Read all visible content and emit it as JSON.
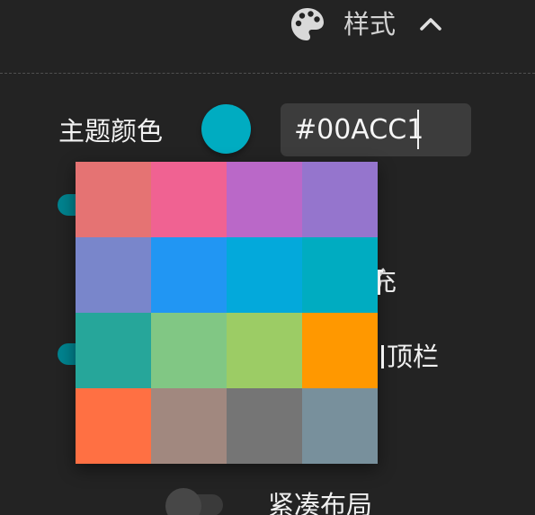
{
  "section": {
    "title": "样式",
    "icon": "palette-icon",
    "toggle_icon": "chevron-up-icon"
  },
  "theme_color": {
    "label": "主题颜色",
    "value": "#00ACC1",
    "swatch_color": "#00ACC1"
  },
  "rows": [
    {
      "label": "填充",
      "visible_label": "真充",
      "toggle_on": true
    },
    {
      "label": "顶栏",
      "visible_label": "D顶栏",
      "toggle_on": true
    },
    {
      "label": "紧凑布局",
      "toggle_on": false
    }
  ],
  "palette": {
    "colors": [
      "#E57373",
      "#F06292",
      "#BA68C8",
      "#9575CD",
      "#7986CB",
      "#2196F3",
      "#03A9DB",
      "#00ACC1",
      "#26A69A",
      "#81C784",
      "#9CCC65",
      "#FF9800",
      "#FF7043",
      "#A1887F",
      "#757575",
      "#78909C"
    ]
  }
}
